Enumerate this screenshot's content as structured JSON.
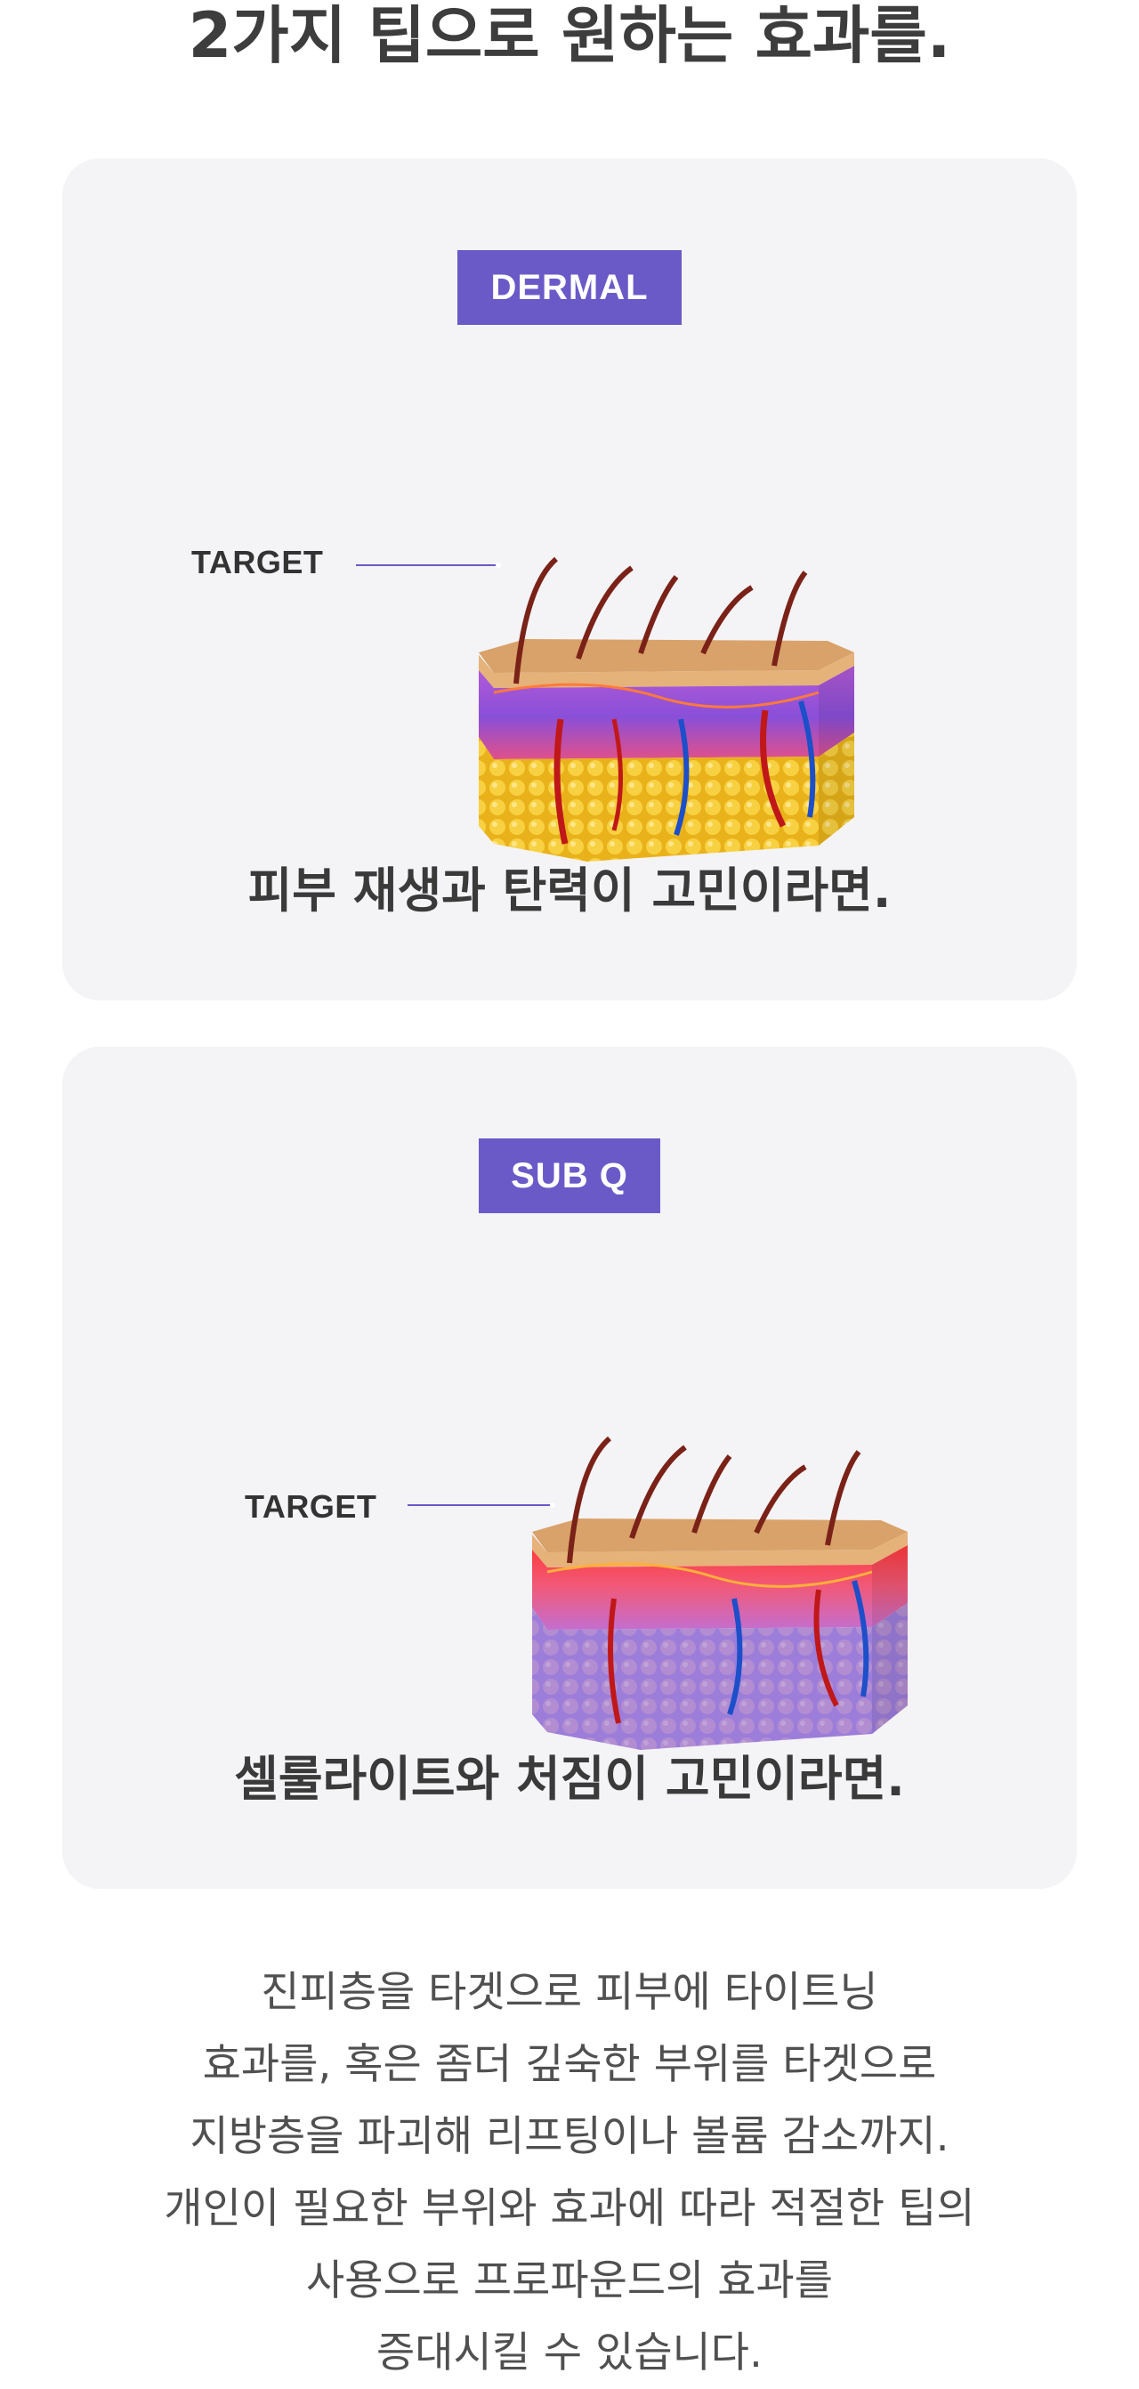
{
  "headline": "2가지 팁으로 원하는 효과를.",
  "cards": [
    {
      "badge": "DERMAL",
      "target_label": "TARGET",
      "caption": "피부 재생과 탄력이 고민이라면."
    },
    {
      "badge": "SUB Q",
      "target_label": "TARGET",
      "caption": "셀룰라이트와 처짐이 고민이라면."
    }
  ],
  "description": [
    "진피층을 타겟으로 피부에 타이트닝",
    "효과를, 혹은 좀더 깊숙한 부위를 타겟으로",
    "지방층을 파괴해 리프팅이나 볼륨 감소까지.",
    "개인이 필요한 부위와 효과에 따라 적절한 팁의",
    "사용으로 프로파운드의 효과를",
    "증대시킬 수 있습니다."
  ],
  "colors": {
    "accent": "#6a5ac8",
    "card_bg": "#f4f3f6"
  }
}
